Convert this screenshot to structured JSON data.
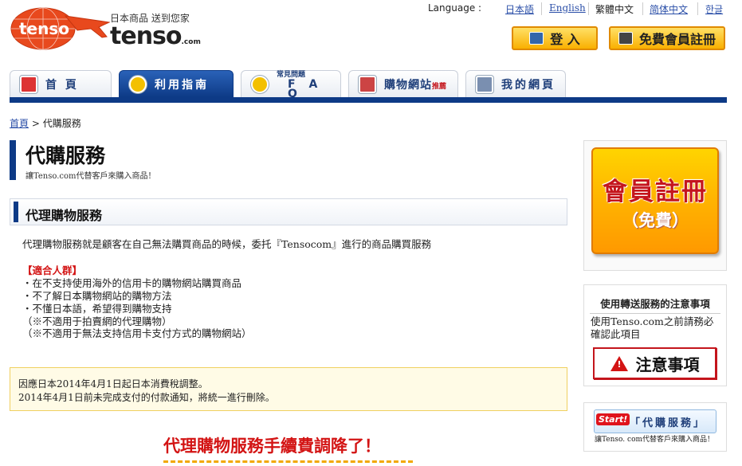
{
  "logo": {
    "name": "tenso",
    "tagline": "日本商品 送到您家",
    "wordmark": "tenso",
    "wordmark_suffix": ".com"
  },
  "language": {
    "label": "Language :",
    "options": [
      "日本語",
      "English",
      "繁體中文",
      "简体中文",
      "한글"
    ],
    "active": "繁體中文"
  },
  "header": {
    "login_label": "登 入",
    "register_label": "免費會員註冊"
  },
  "nav": {
    "tabs": [
      {
        "label": "首 頁",
        "icon": "home-icon"
      },
      {
        "label": "利用指南",
        "icon": "guide-icon"
      },
      {
        "label_top": "常見問題",
        "label": "F A Q",
        "icon": "faq-icon"
      },
      {
        "label": "購物網站",
        "label_suffix": "推薦",
        "icon": "shop-icon"
      },
      {
        "label": "我的網頁",
        "icon": "mypage-icon"
      }
    ],
    "active_index": 1
  },
  "breadcrumb": {
    "home": "首頁",
    "separator": ">",
    "current": "代購服務"
  },
  "page": {
    "title": "代購服務",
    "subtitle": "讓Tenso.com代替客戶來購入商品！",
    "section_title": "代理購物服務",
    "intro": "代理購物服務就是顧客在自己無法購買商品的時候，委托『Tensocom』進行的商品購買服務",
    "suitable_heading": "【適合人群】",
    "suitable_items": [
      "・在不支持使用海外的信用卡的購物網站購買商品",
      "・不了解日本購物網站的購物方法",
      "・不懂日本語，希望得到購物支持",
      "（※不適用于拍賣網的代理購物）",
      "（※不適用于無法支持信用卡支付方式的購物網站）"
    ],
    "notice_lines": [
      "因應日本2014年4月1日起日本消費稅調整。",
      "2014年4月1日前未完成支付的付款通知，將統一進行刪除。"
    ],
    "promo": "代理購物服務手續費調降了！"
  },
  "sidebar": {
    "register_line1": "會員註冊",
    "register_line2": "（免費）",
    "caution_heading": "使用轉送服務的注意事項",
    "caution_text": "使用Tenso.com之前請務必確認此項目",
    "caution_button": "注意事項",
    "start_badge": "Start!",
    "start_text": "「代購服務」",
    "start_sub": "讓Tenso. com代替客戶來購入商品！"
  },
  "colors": {
    "brand_blue": "#0d3a86",
    "accent_orange": "#f9b000",
    "alert_red": "#d31414"
  }
}
